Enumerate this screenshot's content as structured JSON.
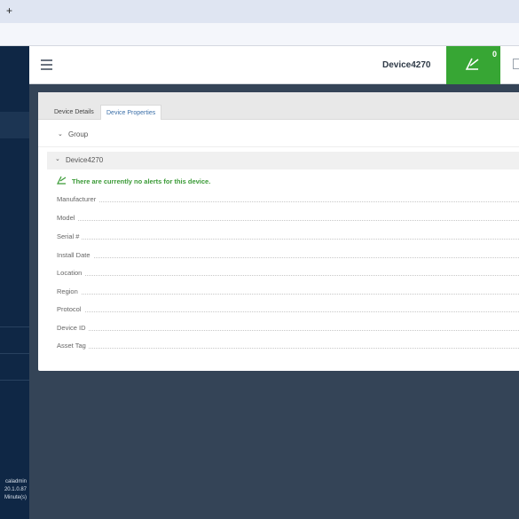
{
  "browser": {
    "new_tab_glyph": "+"
  },
  "sidebar": {
    "footer": [
      "caladmin",
      "20.1.0.87",
      "Minute(s)"
    ]
  },
  "header": {
    "menu_icon": "hamburger-menu-icon",
    "device_title": "Device4270",
    "alert_count": "0",
    "alert_icon": "alert-triangle-icon"
  },
  "tabs": [
    {
      "label": "Device Details",
      "active": false
    },
    {
      "label": "Device Properties",
      "active": true
    }
  ],
  "group": {
    "label": "Group",
    "icon": "chevron-down-icon"
  },
  "device_section": {
    "label": "Device4270",
    "alert_message": "There are currently no alerts for this device.",
    "properties": [
      "Manufacturer",
      "Model",
      "Serial #",
      "Install Date",
      "Location",
      "Region",
      "Protocol",
      "Device ID",
      "Asset Tag"
    ]
  },
  "colors": {
    "accent_green": "#37a634",
    "sidebar_bg": "#0f2745",
    "page_bg": "#344457"
  }
}
